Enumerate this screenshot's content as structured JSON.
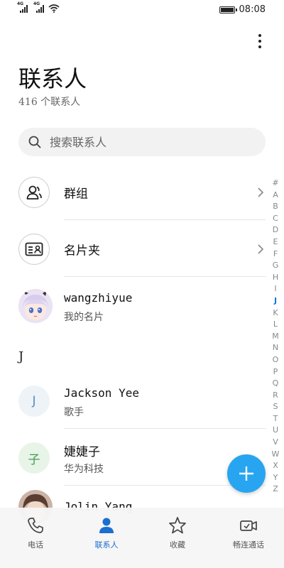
{
  "status_bar": {
    "signal1_tag": "4G",
    "signal2_tag": "4G",
    "time": "08:08"
  },
  "header": {
    "title": "联系人",
    "subtitle": "416 个联系人",
    "more_icon": "more-vertical-icon"
  },
  "search": {
    "placeholder": "搜索联系人",
    "icon": "search-icon"
  },
  "groups": [
    {
      "label": "群组",
      "icon": "group-person-icon"
    },
    {
      "label": "名片夹",
      "icon": "business-card-icon"
    }
  ],
  "my_card": {
    "name": "wangzhiyue",
    "subtitle": "我的名片"
  },
  "section_letter": "J",
  "contacts": [
    {
      "name": "Jackson Yee",
      "subtitle": "歌手",
      "initial": "J",
      "avatar_bg": "#eef3f8",
      "avatar_fg": "#5a8bb8"
    },
    {
      "name": "婕婕子",
      "subtitle": "华为科技",
      "initial": "子",
      "avatar_bg": "#e8f4e8",
      "avatar_fg": "#3f9a52"
    },
    {
      "name": "Jolin Yang",
      "subtitle": "",
      "initial": "",
      "avatar_bg": "#dcccc0",
      "avatar_fg": "#ffffff"
    }
  ],
  "index_letters": [
    "#",
    "A",
    "B",
    "C",
    "D",
    "E",
    "F",
    "G",
    "H",
    "I",
    "J",
    "K",
    "L",
    "M",
    "N",
    "O",
    "P",
    "Q",
    "R",
    "S",
    "T",
    "U",
    "V",
    "W",
    "X",
    "Y",
    "Z"
  ],
  "active_index": "J",
  "fab": {
    "icon": "plus-icon"
  },
  "tabs": [
    {
      "label": "电话",
      "icon": "phone-icon"
    },
    {
      "label": "联系人",
      "icon": "contacts-person-icon",
      "active": true
    },
    {
      "label": "收藏",
      "icon": "star-icon"
    },
    {
      "label": "畅连通话",
      "icon": "video-call-icon"
    }
  ],
  "colors": {
    "accent": "#1a6fd1",
    "fab": "#27a5f0"
  }
}
